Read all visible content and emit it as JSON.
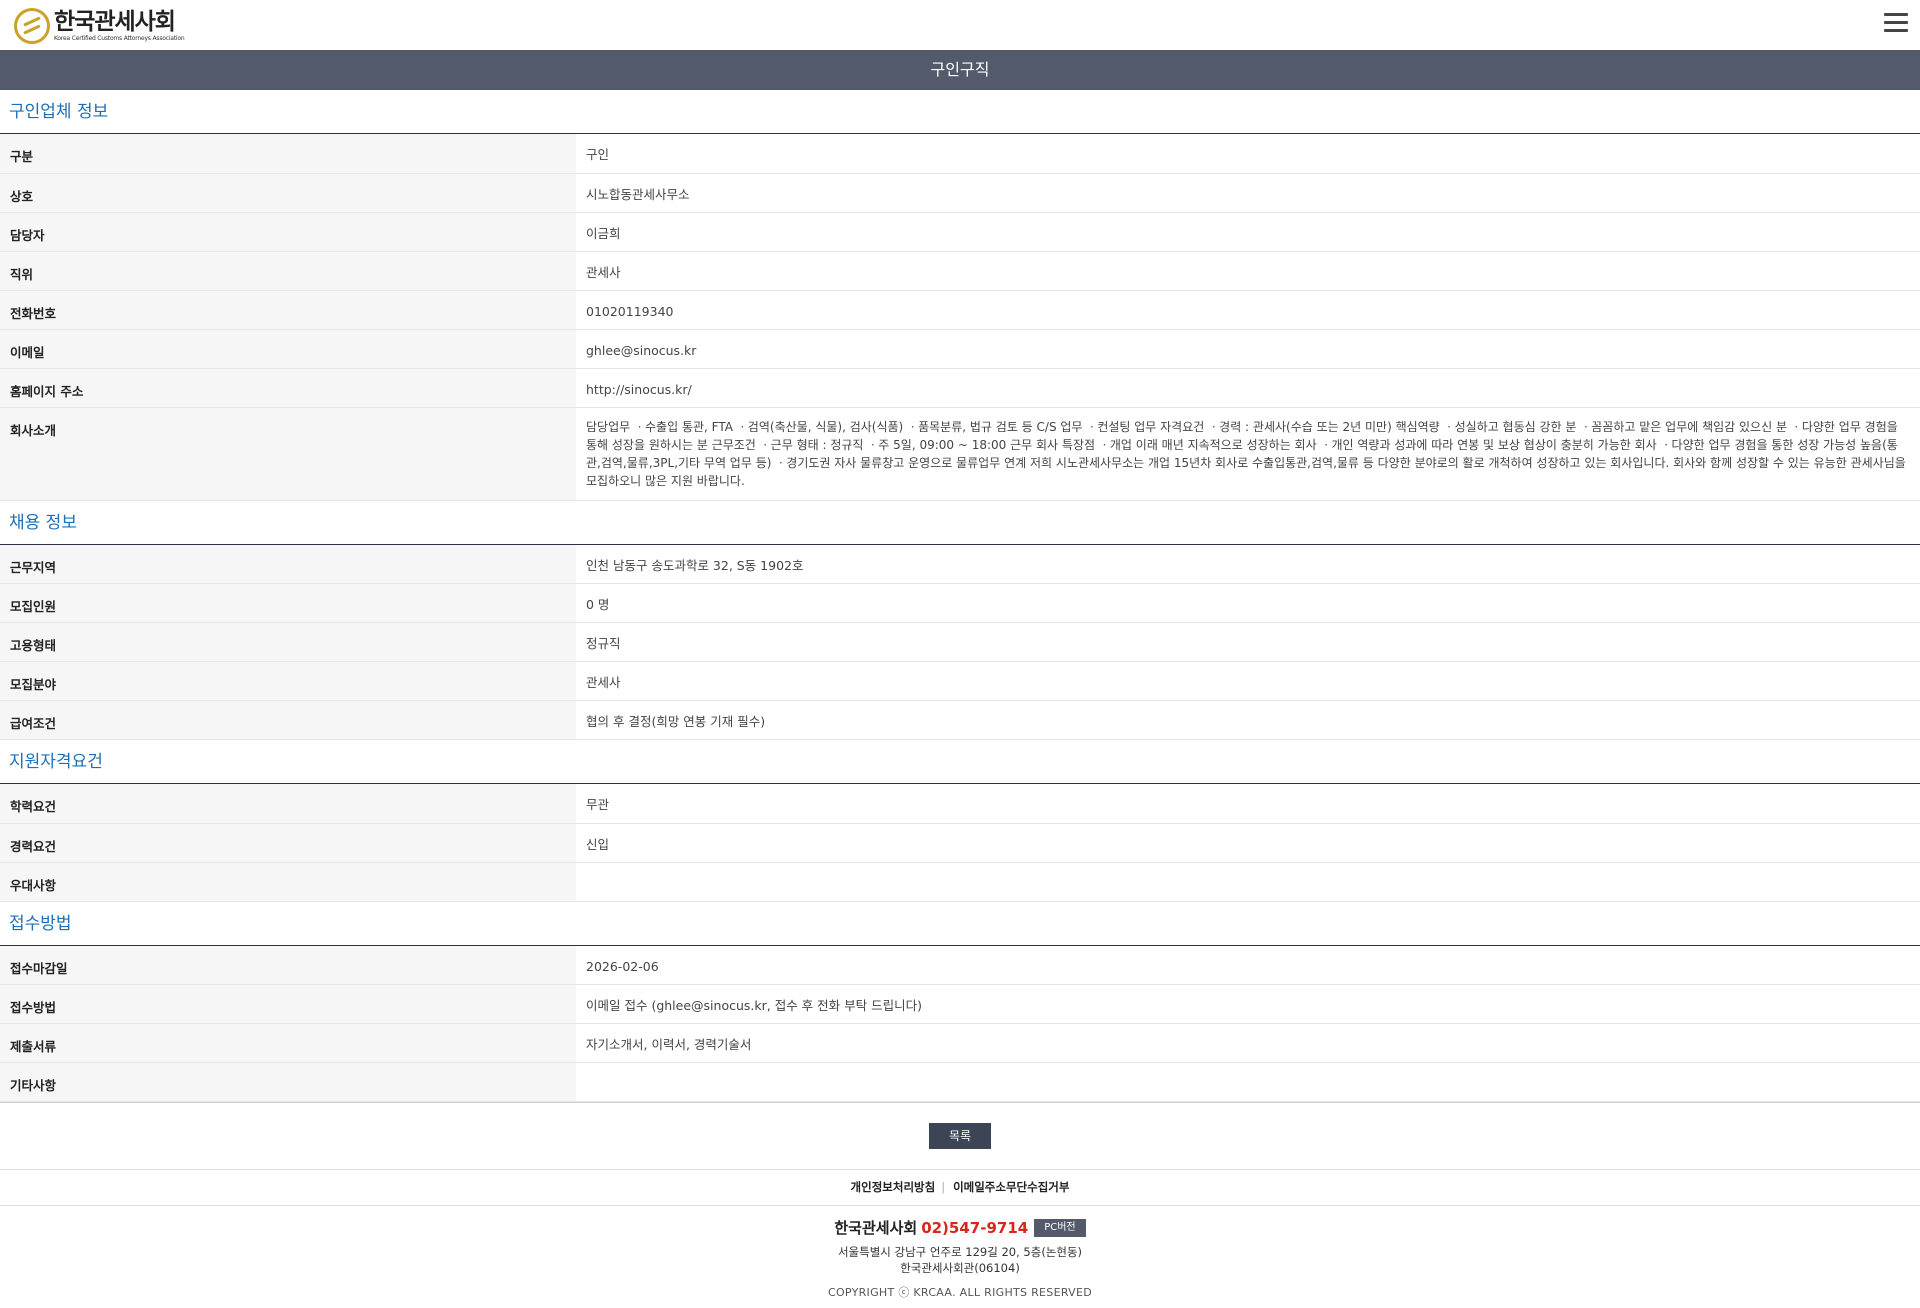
{
  "header": {
    "logo_ko": "한국관세사회",
    "logo_en": "Korea Certified Customs Attorneys Association",
    "menu_icon": "hamburger-menu-icon"
  },
  "page_title": "구인구직",
  "sections": {
    "company": {
      "title": "구인업체 정보",
      "rows": [
        {
          "label": "구분",
          "value": "구인"
        },
        {
          "label": "상호",
          "value": "시노합동관세사무소"
        },
        {
          "label": "담당자",
          "value": "이금희"
        },
        {
          "label": "직위",
          "value": "관세사"
        },
        {
          "label": "전화번호",
          "value": "01020119340"
        },
        {
          "label": "이메일",
          "value": "ghlee@sinocus.kr"
        },
        {
          "label": "홈페이지 주소",
          "value": "http://sinocus.kr/"
        },
        {
          "label": "회사소개",
          "value": "담당업무 ㆍ수출입 통관, FTA ㆍ검역(축산물, 식물), 검사(식품) ㆍ품목분류, 법규 검토 등 C/S 업무 ㆍ컨설팅 업무 자격요건 ㆍ경력 : 관세사(수습 또는 2년 미만) 핵심역량 ㆍ성실하고 협동심 강한 분 ㆍ꼼꼼하고 맡은 업무에 책임감 있으신 분 ㆍ다양한 업무 경험을 통해 성장을 원하시는 분 근무조건 ㆍ근무 형태 : 정규직 ㆍ주 5일, 09:00 ~ 18:00 근무 회사 특장점 ㆍ개업 이래 매년 지속적으로 성장하는 회사 ㆍ개인 역량과 성과에 따라 연봉 및 보상 협상이 충분히 가능한 회사 ㆍ다양한 업무 경험을 통한 성장 가능성 높음(통관,검역,물류,3PL,기타 무역 업무 등) ㆍ경기도권 자사 물류창고 운영으로 물류업무 연계 저희 시노관세사무소는 개업 15년차 회사로 수출입통관,검역,물류 등 다양한 분야로의 활로 개척하여 성장하고 있는 회사입니다. 회사와 함께 성장할 수 있는 유능한 관세사님을 모집하오니 많은 지원 바랍니다."
        }
      ]
    },
    "job": {
      "title": "채용 정보",
      "rows": [
        {
          "label": "근무지역",
          "value": "인천 남동구 송도과학로 32, S동 1902호"
        },
        {
          "label": "모집인원",
          "value": "0 명"
        },
        {
          "label": "고용형태",
          "value": "정규직"
        },
        {
          "label": "모집분야",
          "value": "관세사"
        },
        {
          "label": "급여조건",
          "value": "협의 후 결정(희망 연봉 기재 필수)"
        }
      ]
    },
    "qualification": {
      "title": "지원자격요건",
      "rows": [
        {
          "label": "학력요건",
          "value": "무관"
        },
        {
          "label": "경력요건",
          "value": "신입"
        },
        {
          "label": "우대사항",
          "value": ""
        }
      ]
    },
    "application": {
      "title": "접수방법",
      "rows": [
        {
          "label": "접수마감일",
          "value": "2026-02-06"
        },
        {
          "label": "접수방법",
          "value": "이메일 접수 (ghlee@sinocus.kr, 접수 후 전화 부탁 드립니다)"
        },
        {
          "label": "제출서류",
          "value": "자기소개서, 이력서, 경력기술서"
        },
        {
          "label": "기타사항",
          "value": ""
        }
      ]
    }
  },
  "list_button": "목록",
  "footer": {
    "link_privacy": "개인정보처리방침",
    "link_separator": "|",
    "link_email": "이메일주소무단수집거부",
    "org_name": "한국관세사회",
    "phone": "02)547-9714",
    "pc_version": "PC버전",
    "address_line1": "서울특별시 강남구 언주로 129길 20, 5층(논현동)",
    "address_line2": "한국관세사회관(06104)",
    "copyright": "COPYRIGHT ⓒ KRCAA. ALL RIGHTS RESERVED"
  },
  "colors": {
    "title_bar": "#535a6b",
    "section_title": "#1e6fb8",
    "phone": "#d9261c",
    "logo_gold": "#c9a227"
  }
}
